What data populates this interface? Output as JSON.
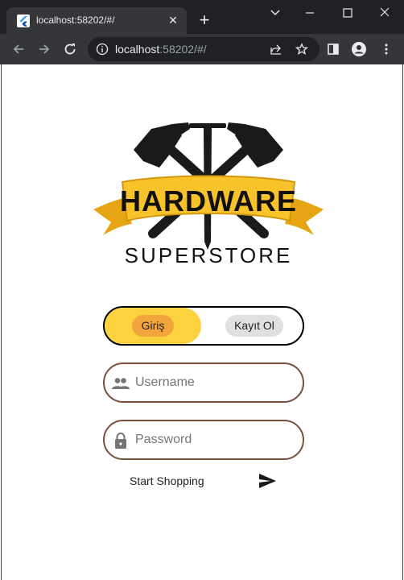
{
  "browser": {
    "tab_title": "localhost:58202/#/",
    "url_host": "localhost",
    "url_path": ":58202/#/"
  },
  "logo": {
    "word1": "HARDWARE",
    "word2": "SUPERSTORE"
  },
  "auth_tabs": {
    "login_label": "Giriş",
    "register_label": "Kayıt Ol"
  },
  "form": {
    "username_placeholder": "Username",
    "password_placeholder": "Password"
  },
  "action": {
    "start_label": "Start Shopping"
  },
  "colors": {
    "toggle_active": "#fcd23f",
    "login_pill": "#f2a53c",
    "field_border": "#7a4d3d"
  }
}
